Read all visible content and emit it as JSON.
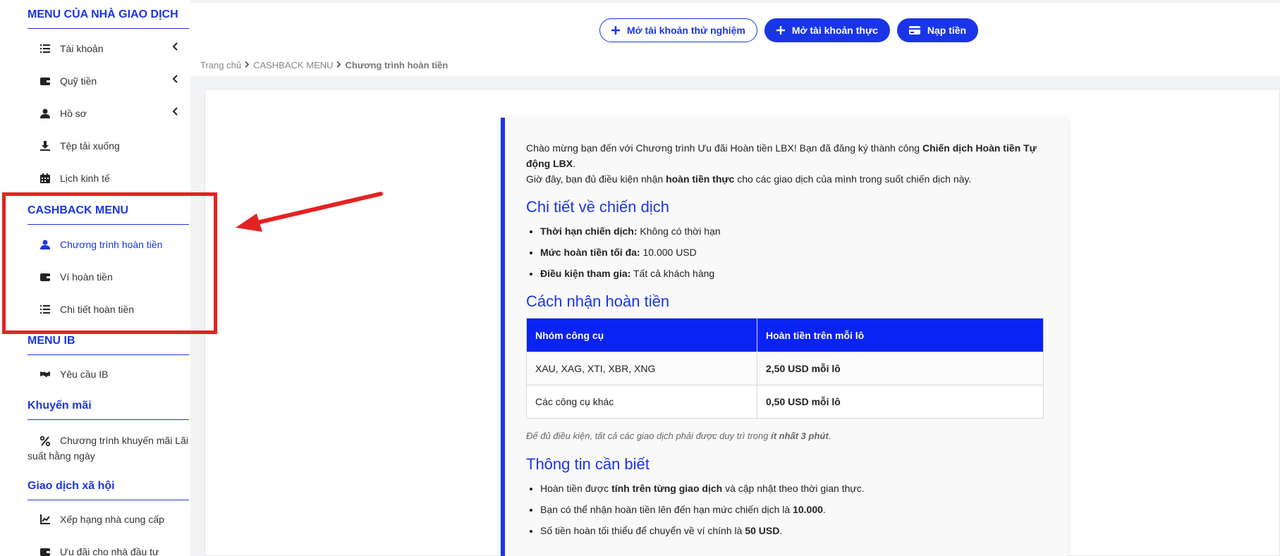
{
  "sidebar": {
    "sections": {
      "trader": "MENU CỦA NHÀ GIAO DỊCH",
      "cashback": "CASHBACK MENU",
      "ib": "MENU IB",
      "promo": "Khuyến mãi",
      "social": "Giao dịch xã hội"
    },
    "items": {
      "account": "Tài khoản",
      "funds": "Quỹ tiền",
      "profile": "Hồ sơ",
      "downloads": "Tệp tải xuống",
      "calendar": "Lịch kinh tế",
      "cashback_program": "Chương trình hoàn tiền",
      "cashback_wallet": "Ví hoàn tiền",
      "cashback_details": "Chi tiết hoàn tiền",
      "ib_request": "Yêu cầu IB",
      "daily_interest": "Chương trình khuyến mãi Lãi suất hằng ngày",
      "provider_rank": "Xếp hạng nhà cung cấp",
      "investor_offers": "Ưu đãi cho nhà đầu tư"
    }
  },
  "header": {
    "demo_btn": "Mở tài khoản thử nghiệm",
    "real_btn": "Mở tài khoản thực",
    "deposit_btn": "Nạp tiền"
  },
  "breadcrumb": {
    "home": "Trang chủ",
    "section": "CASHBACK MENU",
    "current": "Chương trình hoàn tiền"
  },
  "content": {
    "intro_1": "Chào mừng bạn đến với Chương trình Ưu đãi Hoàn tiền LBX! Bạn đã đăng ký thành công ",
    "intro_1_bold": "Chiến dịch Hoàn tiền Tự động LBX",
    "intro_1_end": ".",
    "intro_2": "Giờ đây, bạn đủ điều kiện nhận ",
    "intro_2_bold": "hoàn tiền thực",
    "intro_2_end": " cho các giao dịch của mình trong suốt chiến dịch này.",
    "details_title": "Chi tiết về chiến dịch",
    "details": [
      {
        "label": "Thời hạn chiến dịch:",
        "value": " Không có thời hạn"
      },
      {
        "label": "Mức hoàn tiền tối đa:",
        "value": " 10.000 USD"
      },
      {
        "label": "Điều kiện tham gia:",
        "value": " Tất cả khách hàng"
      }
    ],
    "how_title": "Cách nhận hoàn tiền",
    "table": {
      "headers": [
        "Nhóm công cụ",
        "Hoàn tiền trên mỗi lô"
      ],
      "rows": [
        [
          "XAU, XAG, XTI, XBR, XNG",
          "2,50 USD mỗi lô"
        ],
        [
          "Các công cụ khác",
          "0,50 USD mỗi lô"
        ]
      ]
    },
    "note": "Để đủ điều kiện, tất cả các giao dịch phải được duy trì trong ",
    "note_bold": "ít nhất 3 phút",
    "note_end": ".",
    "info_title": "Thông tin cần biết",
    "info": [
      {
        "pre": "Hoàn tiền được ",
        "bold": "tính trên từng giao dịch",
        "post": " và cập nhật theo thời gian thực."
      },
      {
        "pre": "Bạn có thể nhận hoàn tiền lên đến hạn mức chiến dịch là ",
        "bold": "10.000",
        "post": "."
      },
      {
        "pre": "Số tiền hoàn tối thiểu để chuyển về ví chính là ",
        "bold": "50 USD",
        "post": "."
      }
    ]
  },
  "colors": {
    "accent": "#1a35e8",
    "table_header": "#0a23f5",
    "highlight": "#e52222"
  }
}
